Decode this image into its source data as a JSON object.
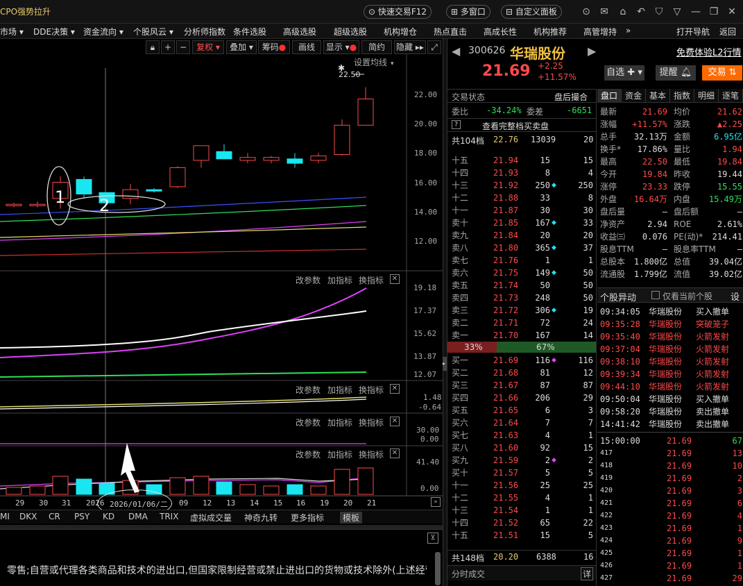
{
  "titlebar": {
    "title": "CPO强势拉升",
    "quick_trade": "快速交易F12",
    "multi_window": "多窗口",
    "custom_panel": "自定义面板"
  },
  "menu": [
    "市场 ▾",
    "DDE决策 ▾",
    "资金流向 ▾",
    "个股风云 ▾",
    "分析师指数",
    "条件选股",
    "高级选股",
    "超级选股",
    "机构增仓",
    "热点直击",
    "高成长性",
    "机构推荐",
    "高管增持",
    "»",
    "打开导航",
    "返回"
  ],
  "toolbar": {
    "fuquan": "复权",
    "diejia": "叠加",
    "chouma": "筹码",
    "huaxian": "画线",
    "xianshi": "显示",
    "jianyue": "简约",
    "yincang": "隐藏"
  },
  "main_chart": {
    "setting": "设置均线",
    "peak": "22.50",
    "annot1": "1",
    "annot2": "2",
    "y_labels": [
      "22.00",
      "20.00",
      "18.00",
      "16.00",
      "14.00",
      "12.00"
    ]
  },
  "sub_panels": {
    "p1": {
      "a": "改参数",
      "b": "加指标",
      "c": "换指标",
      "y": [
        "19.18",
        "17.37",
        "15.62",
        "13.87",
        "12.07"
      ]
    },
    "p2": {
      "a": "改参数",
      "b": "加指标",
      "c": "换指标",
      "y": [
        "1.48",
        "-0.64"
      ]
    },
    "p3": {
      "a": "改参数",
      "b": "加指标",
      "c": "换指标",
      "y": [
        "30.00",
        "0.00"
      ]
    },
    "p4": {
      "a": "改参数",
      "b": "加指标",
      "c": "换指标",
      "y": [
        "41.40",
        "0.00"
      ]
    }
  },
  "xaxis": [
    "29",
    "30",
    "31",
    "2026",
    "2026/01/06/二",
    "09",
    "12",
    "13",
    "14",
    "15",
    "16",
    "19",
    "20",
    "21"
  ],
  "indicator_tabs": [
    "MI",
    "DKX",
    "CR",
    "PSY",
    "KD",
    "DMA",
    "TRIX",
    "虚拟成交量",
    "神奇九转",
    "更多指标",
    "模板"
  ],
  "bottom_text": "零售;自营或代理各类商品和技术的进出口,但国家限制经营或禁止进出口的货物或技术除外(上述经营范",
  "stock": {
    "code": "300626",
    "name": "华瑞股份",
    "price": "21.69",
    "change": "+2.25",
    "pct": "+11.57%",
    "free_l2": "免费体验L2行情",
    "zixuan": "自选",
    "tixing": "提醒",
    "jiaoyi": "交易"
  },
  "ob_header": {
    "status": "交易状态",
    "after": "盘后撮合",
    "weibi_label": "委比",
    "weibi": "-34.24%",
    "weicha_label": "委差",
    "weicha": "-6651",
    "full_btn": "查看完整档买卖盘",
    "total_label": "共104档",
    "total_price": "22.76",
    "total_vol": "13039",
    "total_n": "20"
  },
  "sells": [
    {
      "l": "十五",
      "p": "21.94",
      "v": "15",
      "d": "",
      "n": "15"
    },
    {
      "l": "十四",
      "p": "21.93",
      "v": "8",
      "d": "",
      "n": "4"
    },
    {
      "l": "十三",
      "p": "21.92",
      "v": "250",
      "d": "c",
      "n": "250"
    },
    {
      "l": "十二",
      "p": "21.88",
      "v": "33",
      "d": "",
      "n": "8"
    },
    {
      "l": "十一",
      "p": "21.87",
      "v": "30",
      "d": "",
      "n": "30"
    },
    {
      "l": "卖十",
      "p": "21.85",
      "v": "167",
      "d": "c",
      "n": "33"
    },
    {
      "l": "卖九",
      "p": "21.84",
      "v": "20",
      "d": "",
      "n": "20"
    },
    {
      "l": "卖八",
      "p": "21.80",
      "v": "365",
      "d": "c",
      "n": "37"
    },
    {
      "l": "卖七",
      "p": "21.76",
      "v": "1",
      "d": "",
      "n": "1"
    },
    {
      "l": "卖六",
      "p": "21.75",
      "v": "149",
      "d": "c",
      "n": "50"
    },
    {
      "l": "卖五",
      "p": "21.74",
      "v": "50",
      "d": "",
      "n": "50"
    },
    {
      "l": "卖四",
      "p": "21.73",
      "v": "248",
      "d": "",
      "n": "50"
    },
    {
      "l": "卖三",
      "p": "21.72",
      "v": "306",
      "d": "c",
      "n": "19"
    },
    {
      "l": "卖二",
      "p": "21.71",
      "v": "72",
      "d": "",
      "n": "24"
    },
    {
      "l": "卖一",
      "p": "21.70",
      "v": "167",
      "d": "",
      "n": "14"
    }
  ],
  "ratio": {
    "sell": "33%",
    "buy": "67%"
  },
  "buys": [
    {
      "l": "买一",
      "p": "21.69",
      "v": "116",
      "d": "m",
      "n": "116"
    },
    {
      "l": "买二",
      "p": "21.68",
      "v": "81",
      "d": "",
      "n": "12"
    },
    {
      "l": "买三",
      "p": "21.67",
      "v": "87",
      "d": "",
      "n": "87"
    },
    {
      "l": "买四",
      "p": "21.66",
      "v": "206",
      "d": "",
      "n": "29"
    },
    {
      "l": "买五",
      "p": "21.65",
      "v": "6",
      "d": "",
      "n": "3"
    },
    {
      "l": "买六",
      "p": "21.64",
      "v": "7",
      "d": "",
      "n": "7"
    },
    {
      "l": "买七",
      "p": "21.63",
      "v": "4",
      "d": "",
      "n": "1"
    },
    {
      "l": "买八",
      "p": "21.60",
      "v": "92",
      "d": "",
      "n": "15"
    },
    {
      "l": "买九",
      "p": "21.59",
      "v": "2",
      "d": "m",
      "n": "2"
    },
    {
      "l": "买十",
      "p": "21.57",
      "v": "5",
      "d": "",
      "n": "5"
    },
    {
      "l": "十一",
      "p": "21.56",
      "v": "25",
      "d": "",
      "n": "25"
    },
    {
      "l": "十二",
      "p": "21.55",
      "v": "4",
      "d": "",
      "n": "1"
    },
    {
      "l": "十三",
      "p": "21.54",
      "v": "1",
      "d": "",
      "n": "1"
    },
    {
      "l": "十四",
      "p": "21.52",
      "v": "65",
      "d": "",
      "n": "22"
    },
    {
      "l": "十五",
      "p": "21.51",
      "v": "15",
      "d": "",
      "n": "5"
    }
  ],
  "ob_footer": {
    "total_label": "共148档",
    "price": "20.20",
    "vol": "6388",
    "n": "16",
    "fenshi": "分时成交",
    "xiang": "详"
  },
  "quote_tabs": [
    "盘口",
    "资金",
    "基本",
    "指数",
    "明细",
    "逐笔"
  ],
  "quote": [
    [
      "最新",
      "21.69",
      "r",
      "均价",
      "21.62",
      "r"
    ],
    [
      "涨幅",
      "+11.57%",
      "r",
      "涨跌",
      "▲2.25",
      "r"
    ],
    [
      "总手",
      "32.13万",
      "w",
      "金额",
      "6.95亿",
      "c"
    ],
    [
      "换手*",
      "17.86%",
      "w",
      "量比",
      "1.94",
      "r"
    ],
    [
      "最高",
      "22.50",
      "r",
      "最低",
      "19.84",
      "r"
    ],
    [
      "今开",
      "19.84",
      "r",
      "昨收",
      "19.44",
      "w"
    ],
    [
      "涨停",
      "23.33",
      "r",
      "跌停",
      "15.55",
      "g"
    ],
    [
      "外盘",
      "16.64万",
      "r",
      "内盘",
      "15.49万",
      "g"
    ],
    [
      "盘后量",
      "—",
      "w",
      "盘后额",
      "—",
      "w"
    ],
    [
      "净资产",
      "2.94",
      "w",
      "ROE",
      "2.61%",
      "w"
    ],
    [
      "收益㈢",
      "0.076",
      "w",
      "PE(动)*",
      "214.41",
      "w"
    ],
    [
      "股息TTM",
      "—",
      "w",
      "股息率TTM",
      "—",
      "w"
    ],
    [
      "总股本",
      "1.800亿",
      "w",
      "总值",
      "39.04亿",
      "w"
    ],
    [
      "流通股",
      "1.799亿",
      "w",
      "流值",
      "39.02亿",
      "w"
    ]
  ],
  "movement": {
    "title": "个股异动",
    "only": "仅看当前个股",
    "set": "设",
    "rows": [
      [
        "09:34:05",
        "华瑞股份",
        "买入撤单",
        "w"
      ],
      [
        "09:35:28",
        "华瑞股份",
        "突破笼子",
        "r"
      ],
      [
        "09:35:40",
        "华瑞股份",
        "火箭发射",
        "r"
      ],
      [
        "09:37:04",
        "华瑞股份",
        "火箭发射",
        "r"
      ],
      [
        "09:38:10",
        "华瑞股份",
        "火箭发射",
        "r"
      ],
      [
        "09:39:34",
        "华瑞股份",
        "火箭发射",
        "r"
      ],
      [
        "09:44:10",
        "华瑞股份",
        "火箭发射",
        "r"
      ],
      [
        "09:50:04",
        "华瑞股份",
        "买入撤单",
        "w"
      ],
      [
        "09:58:20",
        "华瑞股份",
        "卖出撤单",
        "w"
      ],
      [
        "14:41:42",
        "华瑞股份",
        "卖出撤单",
        "w"
      ]
    ]
  },
  "ticks": [
    [
      "15:00:00",
      "21.69",
      "67"
    ],
    [
      "417",
      "21.69",
      "13"
    ],
    [
      "418",
      "21.69",
      "10"
    ],
    [
      "419",
      "21.69",
      "2"
    ],
    [
      "420",
      "21.69",
      "3"
    ],
    [
      "421",
      "21.69",
      "6"
    ],
    [
      "422",
      "21.69",
      "4"
    ],
    [
      "423",
      "21.69",
      "1"
    ],
    [
      "424",
      "21.69",
      "9"
    ],
    [
      "425",
      "21.69",
      "1"
    ],
    [
      "426",
      "21.69",
      "1"
    ],
    [
      "427",
      "21.69",
      "29"
    ]
  ],
  "chart_data": {
    "type": "candlestick",
    "dates": [
      "29",
      "30",
      "31",
      "2026",
      "2026/01/06/二",
      "09",
      "12",
      "13",
      "14",
      "15",
      "16",
      "19",
      "20",
      "21"
    ],
    "ohlc": [
      [
        14.4,
        14.6,
        14.3,
        14.5
      ],
      [
        14.5,
        14.7,
        14.3,
        14.5
      ],
      [
        14.9,
        16.4,
        14.2,
        16.0
      ],
      [
        16.2,
        16.4,
        14.9,
        15.2
      ],
      [
        15.3,
        15.3,
        14.5,
        14.6
      ],
      [
        14.9,
        15.9,
        14.5,
        15.5
      ],
      [
        15.5,
        15.6,
        15.3,
        15.4
      ],
      [
        15.7,
        17.1,
        15.6,
        17.0
      ],
      [
        17.5,
        18.5,
        17.0,
        18.5
      ],
      [
        18.1,
        18.6,
        17.6,
        17.6
      ],
      [
        17.5,
        18.0,
        17.3,
        17.7
      ],
      [
        17.5,
        17.8,
        17.3,
        17.7
      ],
      [
        17.6,
        18.0,
        17.0,
        17.3
      ],
      [
        17.5,
        18.0,
        17.3,
        17.8
      ],
      [
        17.9,
        20.3,
        17.8,
        19.9
      ],
      [
        19.9,
        22.5,
        19.9,
        21.69
      ]
    ],
    "ylim": [
      11,
      23
    ]
  }
}
